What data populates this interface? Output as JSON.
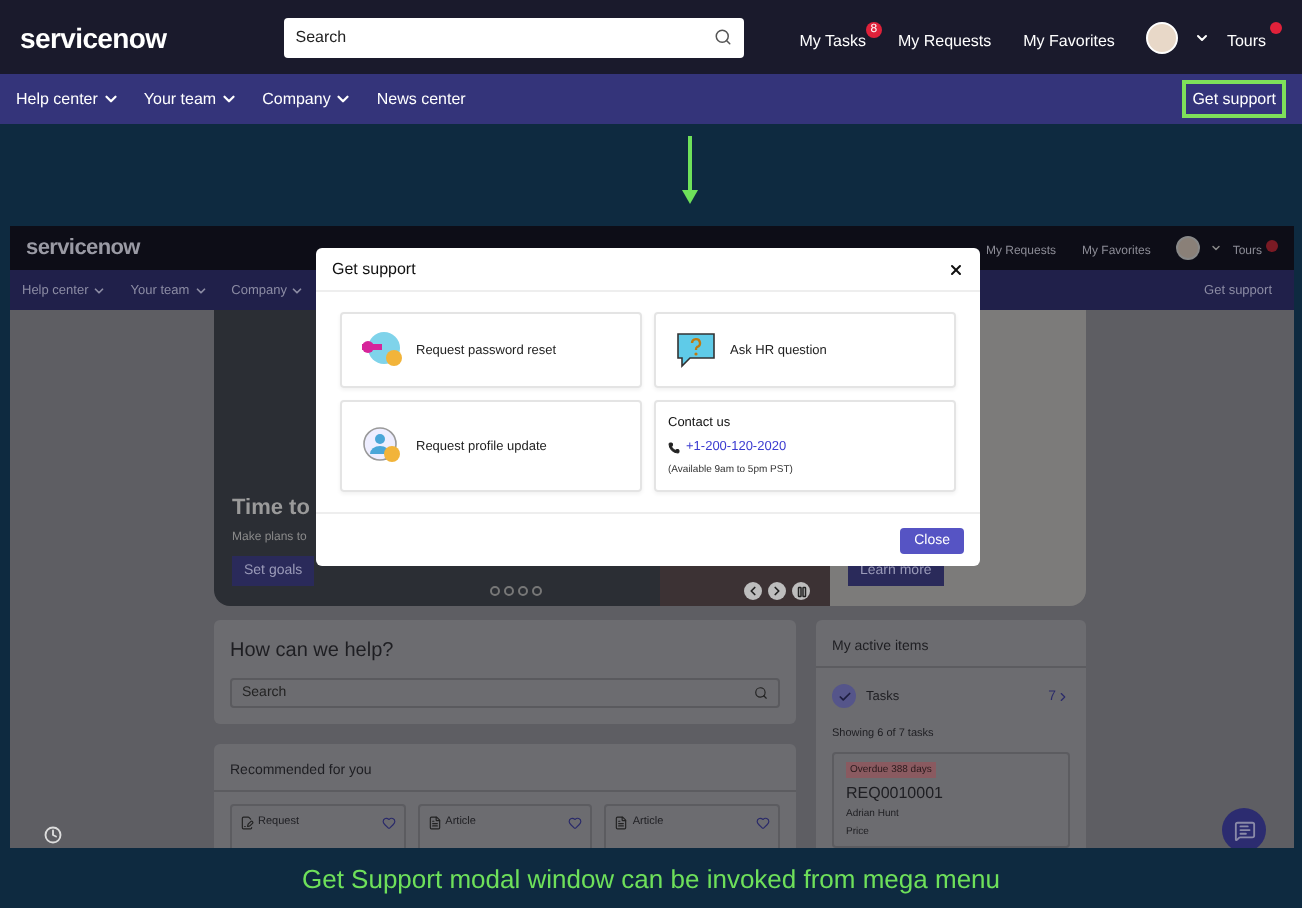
{
  "header": {
    "logo": "servicenow",
    "search": {
      "placeholder": "Search"
    },
    "links": [
      {
        "label": "My Tasks",
        "badge": "8"
      },
      {
        "label": "My Requests"
      },
      {
        "label": "My Favorites"
      }
    ],
    "tours": {
      "label": "Tours",
      "notification": true
    }
  },
  "nav": {
    "items": [
      {
        "label": "Help center",
        "dropdown": true
      },
      {
        "label": "Your team",
        "dropdown": true
      },
      {
        "label": "Company",
        "dropdown": true
      },
      {
        "label": "News center",
        "dropdown": false
      }
    ],
    "action": {
      "label": "Get support",
      "highlighted": true
    }
  },
  "preview": {
    "header": {
      "logo": "servicenow",
      "links": [
        {
          "label": "My Requests"
        },
        {
          "label": "My Favorites"
        }
      ],
      "tours": {
        "label": "Tours",
        "notification": true
      }
    },
    "nav": {
      "items": [
        {
          "label": "Help center",
          "dropdown": true
        },
        {
          "label": "Your team",
          "dropdown": true
        },
        {
          "label": "Company",
          "dropdown": true
        }
      ],
      "action": {
        "label": "Get support",
        "highlighted": false
      }
    },
    "hero": {
      "title": "Time to",
      "text": "Make plans to",
      "button": "Set goals",
      "second_button": "Learn more"
    },
    "help": {
      "title": "How can we help?",
      "search": {
        "placeholder": "Search"
      }
    },
    "recommended": {
      "title": "Recommended for you",
      "cards": [
        {
          "kind": "request",
          "label": "Request"
        },
        {
          "kind": "article",
          "label": "Article"
        },
        {
          "kind": "article",
          "label": "Article"
        }
      ]
    },
    "active_items": {
      "title": "My active items",
      "tasks": {
        "label": "Tasks",
        "count": "7"
      },
      "showing": "Showing 6 of 7 tasks",
      "task": {
        "badge": "Overdue 388 days",
        "number": "REQ0010001",
        "person": "Adrian Hunt",
        "field": "Price"
      }
    },
    "modal": {
      "title": "Get support",
      "tiles": [
        {
          "kind": "action",
          "label": "Request password reset"
        },
        {
          "kind": "action",
          "label": "Ask HR question"
        },
        {
          "kind": "action",
          "label": "Request profile update"
        },
        {
          "kind": "contact",
          "title": "Contact us",
          "phone": "+1-200-120-2020",
          "hours": "(Available 9am to 5pm PST)"
        }
      ],
      "button": "Close"
    }
  },
  "caption": "Get Support modal window can be invoked from mega menu"
}
